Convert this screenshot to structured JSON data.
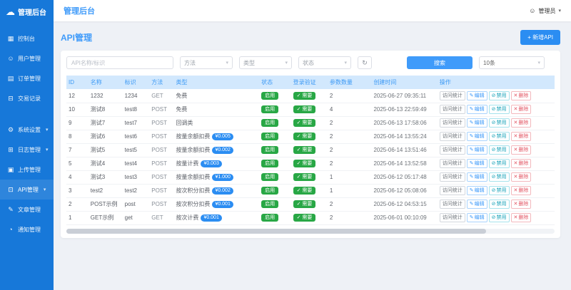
{
  "app": {
    "sidebar_logo": "管理后台",
    "topbar_title": "管理后台",
    "user_menu": {
      "label": "管理员"
    }
  },
  "icons": {
    "cloud": "☁",
    "user": "☺",
    "chevron_down": "▾",
    "refresh": "↻",
    "check": "✓",
    "edit": "✎",
    "disable": "⊘",
    "delete": "✕"
  },
  "sidebar": {
    "items": [
      {
        "key": "console",
        "label": "控制台",
        "glyph": "▦",
        "icon": "dashboard-icon"
      },
      {
        "key": "users",
        "label": "用户管理",
        "glyph": "☺",
        "icon": "users-icon"
      },
      {
        "key": "orders",
        "label": "订单管理",
        "glyph": "▤",
        "icon": "orders-icon"
      },
      {
        "key": "transactions",
        "label": "交易记录",
        "glyph": "⊟",
        "icon": "transactions-icon"
      },
      {
        "key": "settings",
        "label": "系统设置",
        "glyph": "⚙",
        "icon": "gear-icon",
        "chevron": true,
        "group_start": true
      },
      {
        "key": "logs",
        "label": "日志管理",
        "glyph": "⊞",
        "icon": "logs-icon",
        "chevron": true
      },
      {
        "key": "upload",
        "label": "上传管理",
        "glyph": "▣",
        "icon": "upload-icon"
      },
      {
        "key": "api",
        "label": "API管理",
        "glyph": "⊡",
        "icon": "api-icon",
        "chevron": true,
        "active": true
      },
      {
        "key": "articles",
        "label": "文章管理",
        "glyph": "✎",
        "icon": "articles-icon"
      },
      {
        "key": "notifications",
        "label": "通知管理",
        "glyph": "◔",
        "icon": "bell-icon"
      }
    ]
  },
  "page": {
    "title": "API管理",
    "add_api_button": "+ 新增API"
  },
  "filters": {
    "keyword_placeholder": "API名称/标识",
    "method_select": "方法",
    "type_select": "类型",
    "status_select": "状态",
    "search_button": "搜索",
    "page_size_select": "10条"
  },
  "table": {
    "headers": [
      "ID",
      "名称",
      "标识",
      "方法",
      "类型",
      "状态",
      "登录验证",
      "参数数量",
      "创建时间",
      "操作"
    ],
    "action_labels": {
      "stats": "访问统计",
      "edit": "编辑",
      "disable": "禁用",
      "delete": "删除"
    },
    "rows": [
      {
        "id": 12,
        "name": "1232",
        "code": "1234",
        "method": "GET",
        "type": "免费",
        "price": null,
        "status": "启用",
        "auth": "需要",
        "params": 2,
        "created": "2025-06-27 09:35:11"
      },
      {
        "id": 10,
        "name": "测试8",
        "code": "test8",
        "method": "POST",
        "type": "免费",
        "price": null,
        "status": "启用",
        "auth": "需要",
        "params": 4,
        "created": "2025-06-13 22:59:49"
      },
      {
        "id": 9,
        "name": "测试7",
        "code": "test7",
        "method": "POST",
        "type": "回调类",
        "price": null,
        "status": "启用",
        "auth": "需要",
        "params": 2,
        "created": "2025-06-13 17:58:06"
      },
      {
        "id": 8,
        "name": "测试6",
        "code": "test6",
        "method": "POST",
        "type": "按量余额扣费",
        "price": "¥0.005",
        "status": "启用",
        "auth": "需要",
        "params": 2,
        "created": "2025-06-14 13:55:24"
      },
      {
        "id": 7,
        "name": "测试5",
        "code": "test5",
        "method": "POST",
        "type": "按量余额扣费",
        "price": "¥0.002",
        "status": "启用",
        "auth": "需要",
        "params": 2,
        "created": "2025-06-14 13:51:46"
      },
      {
        "id": 5,
        "name": "测试4",
        "code": "test4",
        "method": "POST",
        "type": "按量计费",
        "price": "¥0.003",
        "status": "启用",
        "auth": "需要",
        "params": 2,
        "created": "2025-06-14 13:52:58"
      },
      {
        "id": 4,
        "name": "测试3",
        "code": "test3",
        "method": "POST",
        "type": "按量余额扣费",
        "price": "¥1.000",
        "status": "启用",
        "auth": "需要",
        "params": 1,
        "created": "2025-06-12 05:17:48"
      },
      {
        "id": 3,
        "name": "test2",
        "code": "test2",
        "method": "POST",
        "type": "按次积分扣费",
        "price": "¥0.002",
        "status": "启用",
        "auth": "需要",
        "params": 1,
        "created": "2025-06-12 05:08:06"
      },
      {
        "id": 2,
        "name": "POST示例",
        "code": "post",
        "method": "POST",
        "type": "按次积分扣费",
        "price": "¥0.001",
        "status": "启用",
        "auth": "需要",
        "params": 2,
        "created": "2025-06-12 04:53:15"
      },
      {
        "id": 1,
        "name": "GET示例",
        "code": "get",
        "method": "GET",
        "type": "按次计费",
        "price": "¥0.001",
        "status": "启用",
        "auth": "需要",
        "params": 2,
        "created": "2025-06-01 00:10:09"
      }
    ]
  }
}
